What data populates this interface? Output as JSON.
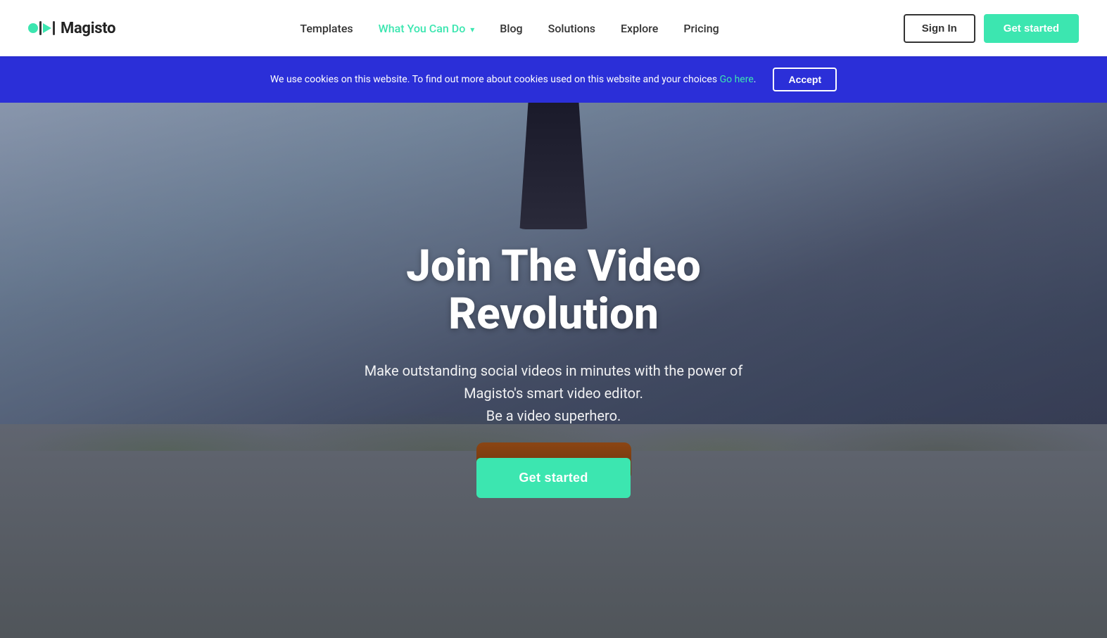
{
  "navbar": {
    "logo_text": "Magisto",
    "links": [
      {
        "id": "templates",
        "label": "Templates",
        "active": false
      },
      {
        "id": "what-you-can-do",
        "label": "What You Can Do",
        "active": true,
        "has_dropdown": true
      },
      {
        "id": "blog",
        "label": "Blog",
        "active": false
      },
      {
        "id": "solutions",
        "label": "Solutions",
        "active": false
      },
      {
        "id": "explore",
        "label": "Explore",
        "active": false
      },
      {
        "id": "pricing",
        "label": "Pricing",
        "active": false
      }
    ],
    "sign_in_label": "Sign In",
    "get_started_label": "Get started"
  },
  "cookie_banner": {
    "text": "We use cookies on this website. To find out more about cookies used on this website and your choices",
    "link_text": "Go here",
    "period": ".",
    "accept_label": "Accept"
  },
  "hero": {
    "title": "Join The Video Revolution",
    "subtitle_line1": "Make outstanding social videos in minutes with the power of",
    "subtitle_line2": "Magisto's smart video editor.",
    "subtitle_line3": "Be a video superhero.",
    "cta_label": "Get started"
  }
}
